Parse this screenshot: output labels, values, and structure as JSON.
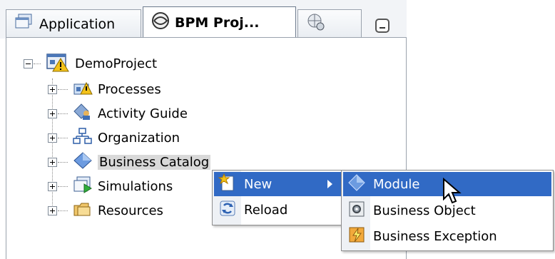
{
  "tabs": [
    {
      "label": "Application",
      "icon": "application-icon"
    },
    {
      "label": "BPM Proj...",
      "icon": "bpm-project-icon"
    },
    {
      "label": "",
      "icon": "globe-gear-icon"
    }
  ],
  "tree": {
    "root": {
      "label": "DemoProject",
      "icon": "project-warning-icon"
    },
    "children": [
      {
        "label": "Processes",
        "icon": "processes-icon"
      },
      {
        "label": "Activity Guide",
        "icon": "activity-guide-icon"
      },
      {
        "label": "Organization",
        "icon": "organization-icon"
      },
      {
        "label": "Business Catalog",
        "icon": "business-catalog-icon"
      },
      {
        "label": "Simulations",
        "icon": "simulations-icon"
      },
      {
        "label": "Resources",
        "icon": "resources-icon"
      }
    ]
  },
  "context_menu": {
    "items": [
      {
        "label": "New",
        "icon": "new-icon",
        "has_submenu": true
      },
      {
        "label": "Reload",
        "icon": "reload-icon"
      }
    ]
  },
  "submenu": {
    "items": [
      {
        "label": "Module",
        "icon": "module-icon"
      },
      {
        "label": "Business Object",
        "icon": "business-object-icon"
      },
      {
        "label": "Business Exception",
        "icon": "business-exception-icon"
      }
    ]
  },
  "colors": {
    "highlight": "#316ac5",
    "selected_bg": "#d9d9d9",
    "border": "#9aa2ad"
  }
}
